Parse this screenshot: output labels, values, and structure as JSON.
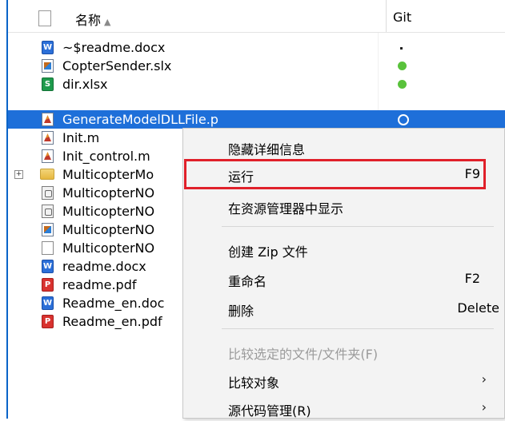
{
  "header": {
    "name_label": "名称",
    "sort_indicator": "▲",
    "git_label": "Git"
  },
  "files": [
    {
      "name": "~$readme.docx",
      "icon": "word-icon",
      "git": "dash"
    },
    {
      "name": "CopterSender.slx",
      "icon": "simulink-model-icon",
      "git": "green"
    },
    {
      "name": "dir.xlsx",
      "icon": "excel-icon",
      "git": "green"
    },
    {
      "name": "GenerateModelDLLFile.p",
      "icon": "matlab-p-file-icon",
      "git": "green-ring"
    },
    {
      "name": "Init.m",
      "icon": "matlab-script-icon",
      "git": ""
    },
    {
      "name": "Init_control.m",
      "icon": "matlab-script-icon",
      "git": ""
    },
    {
      "name": "MulticopterMo",
      "icon": "folder-icon",
      "git": ""
    },
    {
      "name": "MulticopterNO",
      "icon": "simulink-cache-icon",
      "git": ""
    },
    {
      "name": "MulticopterNO",
      "icon": "simulink-cache-icon",
      "git": ""
    },
    {
      "name": "MulticopterNO",
      "icon": "simulink-model-icon",
      "git": ""
    },
    {
      "name": "MulticopterNO",
      "icon": "blank-file-icon",
      "git": ""
    },
    {
      "name": "readme.docx",
      "icon": "word-icon",
      "git": ""
    },
    {
      "name": "readme.pdf",
      "icon": "pdf-icon",
      "git": ""
    },
    {
      "name": "Readme_en.doc",
      "icon": "word-icon",
      "git": ""
    },
    {
      "name": "Readme_en.pdf",
      "icon": "pdf-icon",
      "git": ""
    }
  ],
  "expander_symbol": "+",
  "icon_glyphs": {
    "word": "W",
    "excel": "S",
    "pdf": "P"
  },
  "context_menu": {
    "hide_details": "隐藏详细信息",
    "run": "运行",
    "run_shortcut": "F9",
    "show_in_explorer": "在资源管理器中显示",
    "create_zip": "创建 Zip 文件",
    "rename": "重命名",
    "rename_shortcut": "F2",
    "delete": "删除",
    "delete_shortcut": "Delete",
    "compare_selected": "比较选定的文件/文件夹(F)",
    "compare_to": "比较对象",
    "source_control": "源代码管理(R)",
    "submenu_arrow": "›"
  },
  "colors": {
    "selection": "#1e6fd9",
    "highlight_box": "#e0202a",
    "git_green": "#59c23b"
  }
}
